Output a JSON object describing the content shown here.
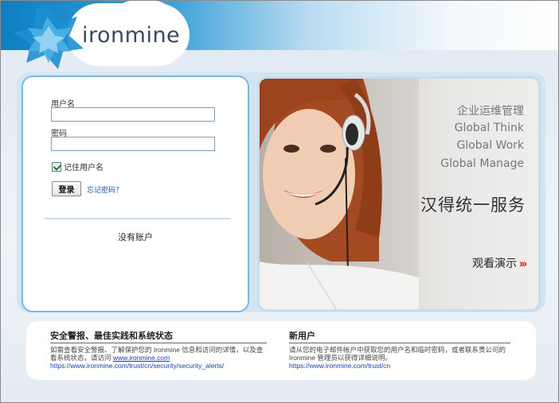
{
  "brand": {
    "logo_text": "ironmine"
  },
  "login": {
    "username_label": "用户名",
    "username_value": "",
    "password_label": "密码",
    "password_value": "",
    "remember_label": "记住用户名",
    "remember_checked": true,
    "login_button": "登录",
    "forgot_link": "忘记密码？",
    "no_account": "没有账户"
  },
  "promo": {
    "lines": [
      "企业运维管理",
      "Global Think",
      "Global Work",
      "Global Manage"
    ],
    "headline": "汉得统一服务",
    "demo_label": "观看演示",
    "demo_arrows": "›››",
    "arrow_color": "#d2281e"
  },
  "info": {
    "security": {
      "title": "安全警报、最佳实践和系统状态",
      "text": "如需查看安全警报、了解保护您的 Ironmine 信息和访问的详情，以及查看系统状态，请访问",
      "link1": "www.ironmine.com",
      "link2": "https://www.ironmine.com/trust/cn/security/security_alerts/"
    },
    "new_user": {
      "title": "新用户",
      "text": "请从您的电子邮件帐户中获取您的用户名和临时密码，或者联系贵公司的 Ironmine 管理员以获得详细说明。",
      "link": "https://www.ironmine.com/trust/cn"
    }
  },
  "colors": {
    "accent": "#0d7ec4",
    "link": "#1a55a8",
    "panel_border": "#7ab7e2"
  }
}
